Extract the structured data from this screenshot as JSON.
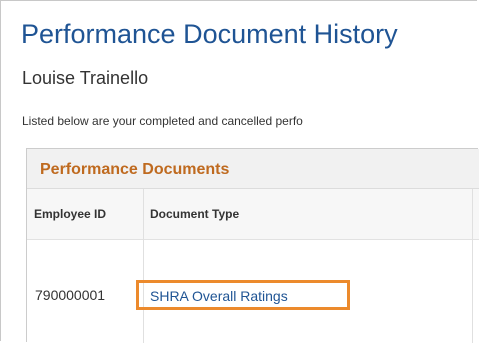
{
  "page": {
    "title": "Performance Document History",
    "employee_name": "Louise Trainello",
    "description": "Listed below are your completed and cancelled perfo"
  },
  "grid": {
    "title": "Performance Documents",
    "columns": [
      "Employee ID",
      "Document Type"
    ],
    "rows": [
      {
        "employee_id": "790000001",
        "document_type": "SHRA Overall Ratings"
      }
    ]
  },
  "colors": {
    "title_blue": "#1f5494",
    "grid_title_orange": "#bf6a1f",
    "highlight_orange": "#ec8a2c",
    "link_blue": "#1f5494"
  }
}
